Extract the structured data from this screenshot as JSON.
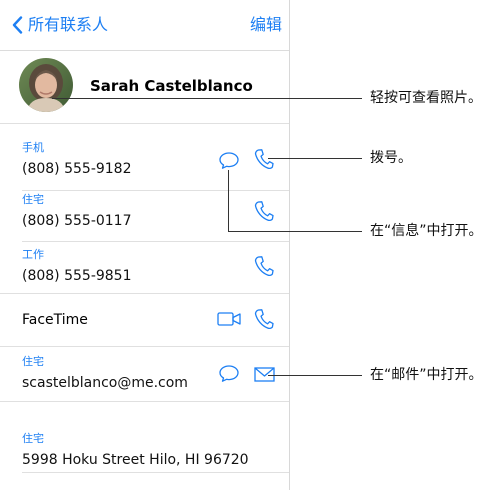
{
  "navbar": {
    "back_label": "所有联系人",
    "edit_label": "编辑"
  },
  "contact": {
    "name": "Sarah Castelblanco"
  },
  "phones": [
    {
      "label": "手机",
      "value": "(808) 555-9182"
    },
    {
      "label": "住宅",
      "value": "(808) 555-0117"
    },
    {
      "label": "工作",
      "value": "(808) 555-9851"
    }
  ],
  "facetime": {
    "label": "FaceTime"
  },
  "email": {
    "label": "住宅",
    "value": "scastelblanco@me.com"
  },
  "address": {
    "label": "住宅",
    "value": "5998 Hoku Street Hilo, HI 96720"
  },
  "callouts": {
    "photo": "轻按可查看照片。",
    "dial": "拨号。",
    "message": "在“信息”中打开。",
    "mail": "在“邮件”中打开。"
  },
  "icons": {
    "back": "chevron-left-icon",
    "message": "speech-bubble-icon",
    "phone": "phone-handset-icon",
    "video": "video-camera-icon",
    "mail": "envelope-icon"
  },
  "colors": {
    "accent": "#1d7ff3",
    "callout_line": "#333333"
  }
}
